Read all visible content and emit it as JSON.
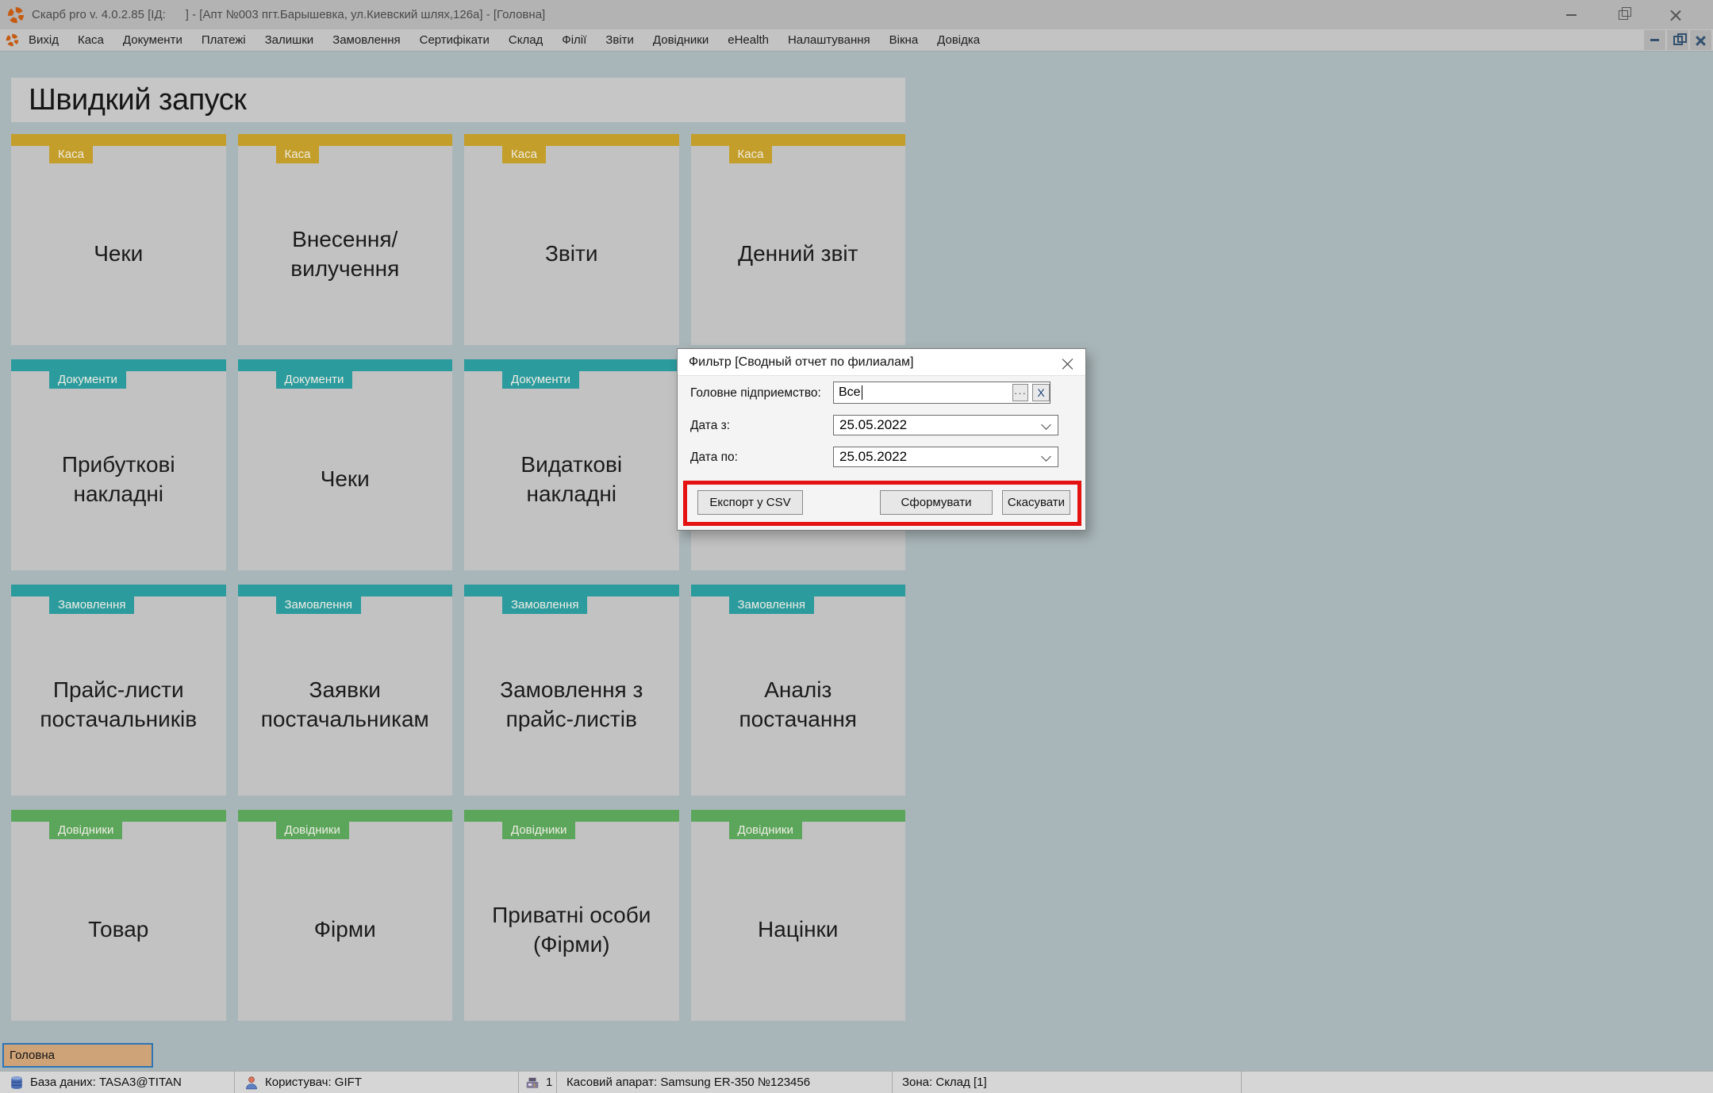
{
  "window": {
    "title": "Скарб pro v. 4.0.2.85 [ІД:      ] - [Апт №003 пгт.Барышевка, ул.Киевский шлях,126а] - [Головна]"
  },
  "menu": {
    "items": [
      "Вихід",
      "Каса",
      "Документи",
      "Платежі",
      "Залишки",
      "Замовлення",
      "Сертифікати",
      "Склад",
      "Філії",
      "Звіти",
      "Довідники",
      "eHealth",
      "Налаштування",
      "Вікна",
      "Довідка"
    ]
  },
  "quick_launch": {
    "title": "Швидкий запуск",
    "tiles": [
      {
        "category": "Каса",
        "label": "Чеки"
      },
      {
        "category": "Каса",
        "label": "Внесення/вилучення"
      },
      {
        "category": "Каса",
        "label": "Звіти"
      },
      {
        "category": "Каса",
        "label": "Денний звіт"
      },
      {
        "category": "Документи",
        "label": "Прибуткові накладні"
      },
      {
        "category": "Документи",
        "label": "Чеки"
      },
      {
        "category": "Документи",
        "label": "Видаткові накладні"
      },
      {
        "category": "",
        "label": ""
      },
      {
        "category": "Замовлення",
        "label": "Прайс-листи постачальників"
      },
      {
        "category": "Замовлення",
        "label": "Заявки постачальникам"
      },
      {
        "category": "Замовлення",
        "label": "Замовлення з прайс-листів"
      },
      {
        "category": "Замовлення",
        "label": "Аналіз постачання"
      },
      {
        "category": "Довідники",
        "label": "Товар"
      },
      {
        "category": "Довідники",
        "label": "Фірми"
      },
      {
        "category": "Довідники",
        "label": "Приватні особи (Фірми)"
      },
      {
        "category": "Довідники",
        "label": "Націнки"
      }
    ]
  },
  "category_colors": {
    "Каса": "#C49E2A",
    "Документи": "#2B9B9E",
    "Замовлення": "#2B9B9E",
    "Довідники": "#5CA65C"
  },
  "dialog": {
    "title": "Фильтр [Сводный отчет по филиалам]",
    "fields": [
      {
        "label": "Головне підприемство:",
        "value": "Все"
      },
      {
        "label": "Дата з:",
        "value": "25.05.2022"
      },
      {
        "label": "Дата по:",
        "value": "25.05.2022"
      }
    ],
    "lookup_button": "···",
    "clear_button": "X",
    "buttons": [
      "Експорт у CSV",
      "Сформувати",
      "Скасувати"
    ],
    "highlight_color": "#E51212"
  },
  "tab_bar": {
    "tabs": [
      {
        "label": "Головна",
        "active": true
      }
    ]
  },
  "status_bar": {
    "items": [
      {
        "icon": "database-icon",
        "text": "База даних: TASA3@TITAN"
      },
      {
        "icon": "user-icon",
        "text": "Користувач: GIFT"
      },
      {
        "icon": "cash-register-icon",
        "text": "1"
      },
      {
        "icon": null,
        "text": "Касовий апарат: Samsung ER-350 №123456"
      },
      {
        "icon": null,
        "text": "Зона: Склад [1]"
      }
    ]
  },
  "icons": {
    "app_logo": "app-logo-icon",
    "window": [
      "minimize-icon",
      "restore-icon",
      "close-icon"
    ],
    "status": [
      "database-icon",
      "user-icon",
      "cash-register-icon"
    ],
    "combo": "chevron-down-icon"
  },
  "ui_colors": {
    "mdi_background": "#A9B6B9",
    "titlebar": "#B3B3B3",
    "menubar": "#C3C3C3",
    "panel": "#C6C6C6",
    "tile": "#C2C2C2",
    "tab": "#CFA378",
    "tab_border": "#2E75B6",
    "statusbar": "#D6D6D6",
    "logo_orange": "#C65A11"
  }
}
